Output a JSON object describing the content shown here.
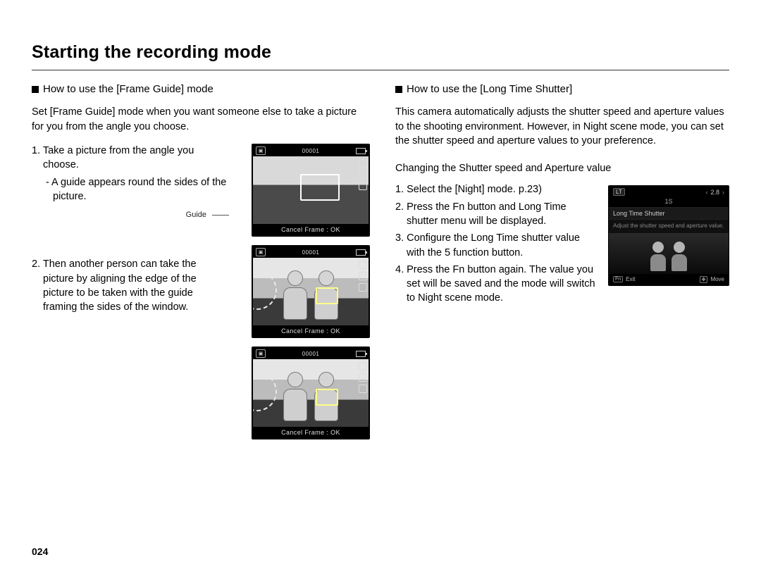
{
  "page": {
    "title": "Starting the recording mode",
    "number": "024"
  },
  "left": {
    "subhead": "How to use the [Frame Guide] mode",
    "intro": "Set [Frame Guide] mode when you want someone else to take a picture for you from the angle you choose.",
    "step1": "1. Take a picture from the angle you choose.",
    "step1sub": "- A guide appears round the sides of the picture.",
    "guide_label": "Guide",
    "step2": "2. Then another person can take the picture by aligning the edge of the picture to be taken with the guide framing the sides of the window.",
    "lcd_counter": "00001",
    "lcd_bottom": "Cancel Frame : OK"
  },
  "right": {
    "subhead": "How to use the [Long Time Shutter]",
    "intro": "This camera automatically adjusts the shutter speed and aperture values to the shooting environment. However, in Night scene mode, you can set the shutter speed and aperture values to your preference.",
    "section_heading": "Changing the Shutter speed and Aperture value",
    "step1": "1.  Select the [Night] mode.  p.23)",
    "step2": "2. Press the Fn button and Long Time shutter menu will be displayed.",
    "step3": "3. Configure the Long Time shutter value with the 5 function button.",
    "step4": "4. Press the Fn button again. The value you set will be saved and the mode will switch to Night scene mode.",
    "night_lcd": {
      "lt": "LT",
      "aperture": "2.8",
      "shutter": "1S",
      "section": "Long Time Shutter",
      "desc": "Adjust the shutter speed and aperture value.",
      "exit": "Exit",
      "move": "Move"
    }
  }
}
